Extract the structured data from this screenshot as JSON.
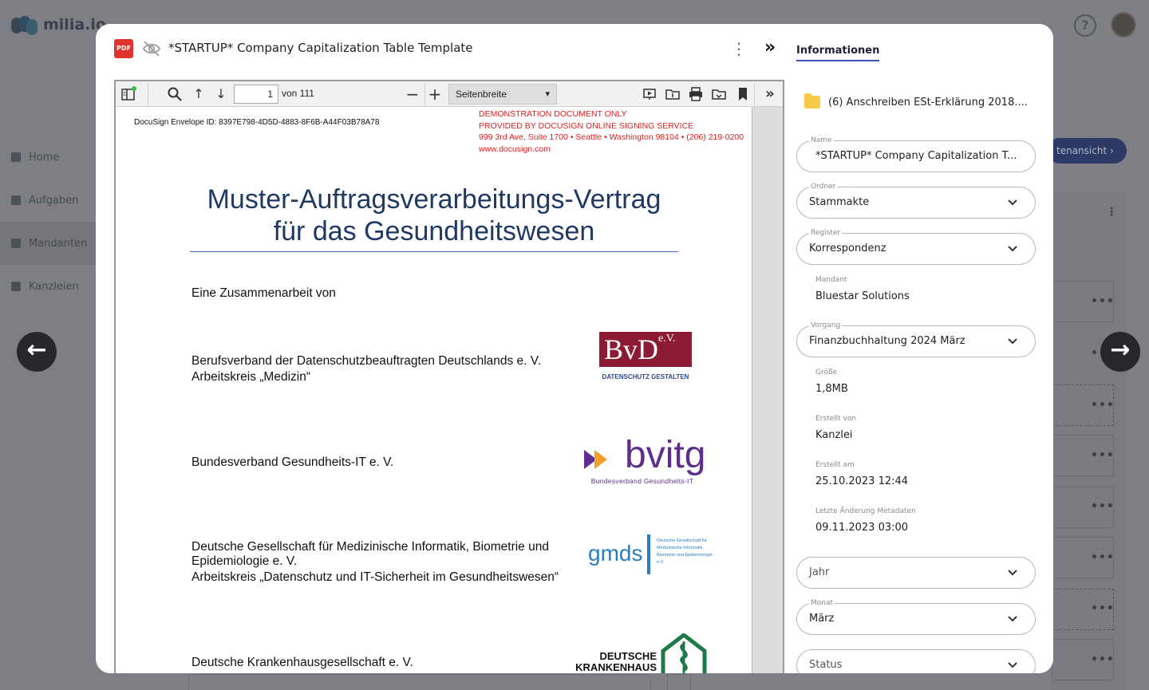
{
  "background": {
    "logo_text": "milia.io",
    "help_label": "?",
    "nav": [
      {
        "label": "Home",
        "icon": "home-icon"
      },
      {
        "label": "Aufgaben",
        "icon": "tasks-icon"
      },
      {
        "label": "Mandanten",
        "icon": "clients-icon"
      },
      {
        "label": "Kanzleien",
        "icon": "office-icon"
      }
    ],
    "pill_label": "tenansicht"
  },
  "modal": {
    "file_type": "PDF",
    "title": "*STARTUP* Company Capitalization Table Template",
    "viewer": {
      "page_number": "1",
      "page_total_label": "von 111",
      "zoom_value": "Seitenbreite"
    },
    "document": {
      "envelope_id": "DocuSign Envelope ID: 8397E798-4D5D-4883-8F6B-A44F03B78A78",
      "demo_lines": [
        "DEMONSTRATION DOCUMENT ONLY",
        "PROVIDED BY DOCUSIGN ONLINE SIGNING SERVICE",
        "999 3rd Ave, Suite 1700  • Seattle • Washington 98104 • (206) 219-0200",
        "www.docusign.com"
      ],
      "title_line1": "Muster-Auftragsverarbeitungs-Vertrag",
      "title_line2": "für das Gesundheitswesen",
      "intro": "Eine Zusammenarbeit von",
      "org1_line1": "Berufsverband der Datenschutzbeauftragten Deutschlands e. V.",
      "org1_line2": "Arbeitskreis „Medizin“",
      "org2": "Bundesverband Gesundheits-IT e. V.",
      "org3_line1": "Deutsche Gesellschaft für Medizinische Informatik, Biometrie und",
      "org3_line2": "Epidemiologie e. V.",
      "org3_line3": "Arbeitskreis „Datenschutz und IT-Sicherheit im Gesundheitswesen“",
      "org4": "Deutsche Krankenhausgesellschaft e. V.",
      "logo_bvd_main": "BvD",
      "logo_bvd_sup": "e.V.",
      "logo_bvd_sub": "DATENSCHUTZ GESTALTEN",
      "logo_bvitg_word": "bvitg",
      "logo_bvitg_sub": "Bundesverband Gesundheits-IT",
      "logo_gmds_word": "gmds",
      "logo_gmds_sub": "Deutsche Gesellschaft für Medizinische Informatik, Biometrie und Epidemiologie e.V.",
      "logo_dkg_line1": "DEUTSCHE",
      "logo_dkg_line2": "KRANKENHAUS"
    }
  },
  "info": {
    "tab_label": "Informationen",
    "folder_path": "(6)  Anschreiben ESt-Erklärung 2018....",
    "name": {
      "label": "Name",
      "value": "*STARTUP* Company Capitalization T..."
    },
    "ordner": {
      "label": "Ordner",
      "value": "Stammakte"
    },
    "register": {
      "label": "Register",
      "value": "Korrespondenz"
    },
    "mandant": {
      "label": "Mandant",
      "value": "Bluestar Solutions"
    },
    "vorgang": {
      "label": "Vorgang",
      "value": "Finanzbuchhaltung 2024 März"
    },
    "groesse": {
      "label": "Größe",
      "value": "1,8MB"
    },
    "erstellt_von": {
      "label": "Erstellt von",
      "value": "Kanzlei"
    },
    "erstellt_am": {
      "label": "Erstellt am",
      "value": "25.10.2023 12:44"
    },
    "letzte_aenderung": {
      "label": "Letzte Änderung Metadaten",
      "value": "09.11.2023 03:00"
    },
    "jahr": {
      "placeholder": "Jahr"
    },
    "monat": {
      "label": "Monat",
      "value": "März"
    },
    "status": {
      "placeholder": "Status"
    }
  },
  "colors": {
    "accent": "#3b4fb8",
    "pdf_badge": "#e0332e",
    "doc_title": "#1f3864",
    "demo_text": "#e02020"
  }
}
